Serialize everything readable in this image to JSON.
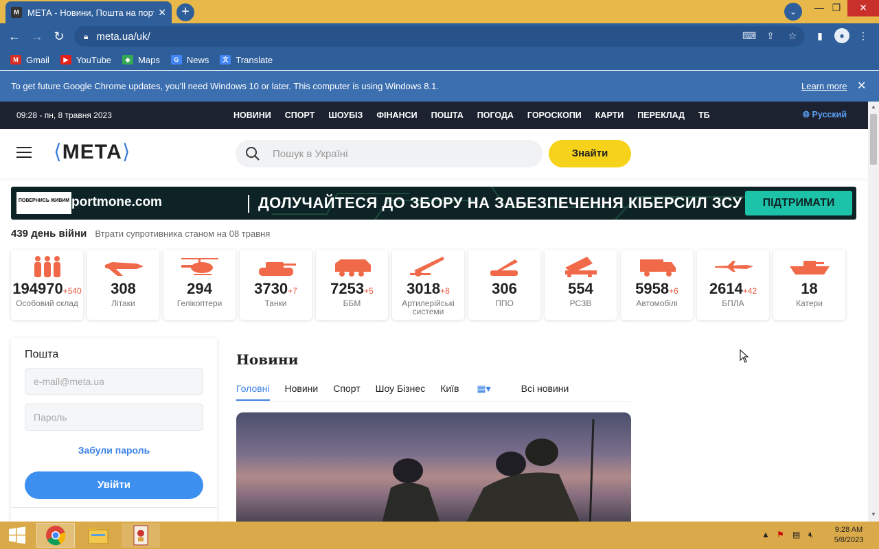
{
  "browser": {
    "tab_title": "МЕТА - Новини, Пошта на порт…",
    "tab_favicon": "M",
    "url": "meta.ua/uk/",
    "bookmarks": [
      {
        "label": "Gmail",
        "icon": "gmail-icon",
        "color": "#d93025"
      },
      {
        "label": "YouTube",
        "icon": "youtube-icon",
        "color": "#e62117"
      },
      {
        "label": "Maps",
        "icon": "maps-icon",
        "color": "#34a853"
      },
      {
        "label": "News",
        "icon": "news-icon",
        "color": "#4285f4"
      },
      {
        "label": "Translate",
        "icon": "translate-icon",
        "color": "#4285f4"
      }
    ],
    "infobar": {
      "message": "To get future Google Chrome updates, you'll need Windows 10 or later. This computer is using Windows 8.1.",
      "learn_more": "Learn more"
    }
  },
  "site": {
    "date": "09:28 - пн, 8 травня 2023",
    "nav": [
      "НОВИНИ",
      "СПОРТ",
      "ШОУБІЗ",
      "ФІНАНСИ",
      "ПОШТА",
      "ПОГОДА",
      "ГОРОСКОПИ",
      "КАРТИ",
      "ПЕРЕКЛАД",
      "ТБ"
    ],
    "lang": "Русский",
    "logo": "МЕТА",
    "search_placeholder": "Пошук в Україні",
    "search_button": "Знайти",
    "banner": {
      "badge": "ПОВЕРНИСЬ ЖИВИМ",
      "brand": "portmone.com",
      "slogan": "ДОЛУЧАЙТЕСЯ ДО ЗБОРУ НА ЗАБЕЗПЕЧЕННЯ КІБЕРСИЛ ЗСУ",
      "cta": "ПІДТРИМАТИ"
    },
    "war_day": "439 день війни",
    "losses_caption": "Втрати супротивника станом на 08 травня",
    "losses": [
      {
        "value": "194970",
        "delta": "+540",
        "label": "Особовий склад",
        "icon": "personnel-icon"
      },
      {
        "value": "308",
        "delta": "",
        "label": "Літаки",
        "icon": "aircraft-icon"
      },
      {
        "value": "294",
        "delta": "",
        "label": "Гелікоптери",
        "icon": "helicopter-icon"
      },
      {
        "value": "3730",
        "delta": "+7",
        "label": "Танки",
        "icon": "tank-icon"
      },
      {
        "value": "7253",
        "delta": "+5",
        "label": "ББМ",
        "icon": "apc-icon"
      },
      {
        "value": "3018",
        "delta": "+8",
        "label": "Артилерійські системи",
        "icon": "artillery-icon"
      },
      {
        "value": "306",
        "delta": "",
        "label": "ППО",
        "icon": "air-defense-icon"
      },
      {
        "value": "554",
        "delta": "",
        "label": "РСЗВ",
        "icon": "mlrs-icon"
      },
      {
        "value": "5958",
        "delta": "+6",
        "label": "Автомобілі",
        "icon": "truck-icon"
      },
      {
        "value": "2614",
        "delta": "+42",
        "label": "БПЛА",
        "icon": "drone-icon"
      },
      {
        "value": "18",
        "delta": "",
        "label": "Катери",
        "icon": "boat-icon"
      }
    ],
    "mail": {
      "title": "Пошта",
      "email_placeholder": "e-mail@meta.ua",
      "password_placeholder": "Пароль",
      "forgot": "Забули пароль",
      "login": "Увійти"
    },
    "news": {
      "title": "Новини",
      "tabs": [
        "Головні",
        "Новини",
        "Спорт",
        "Шоу Бізнес",
        "Київ",
        "Всі новини"
      ]
    }
  },
  "taskbar": {
    "time": "9:28 AM",
    "date": "5/8/2023"
  },
  "colors": {
    "accent": "#3b82e6",
    "icon_red": "#f06a4a",
    "find_button": "#f6d21a"
  }
}
